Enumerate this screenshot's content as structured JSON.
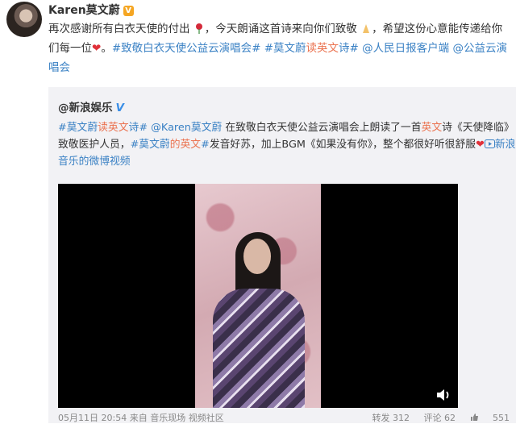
{
  "post": {
    "author": "Karen莫文蔚",
    "text_1": "再次感谢所有白衣天使的付出",
    "text_2": "，今天朗诵这首诗来向你们致敬",
    "text_3": "，希望这份心意能传递给你们每一位",
    "heart": "❤",
    "text_4": "。",
    "tag_1": "#致敬白衣天使公益云演唱会#",
    "tag_2a": "#莫文蔚",
    "tag_2b": "读",
    "tag_2c": "英文",
    "tag_2d": "诗#",
    "mention_1": "@人民日报客户端",
    "mention_2": "@公益云演唱会"
  },
  "repost": {
    "author": "@新浪娱乐",
    "verified": "V",
    "tag_a": "#莫文蔚",
    "tag_b": "读",
    "tag_c": "英文",
    "tag_d": "诗#",
    "mention": "@Karen莫文蔚",
    "text_1": " 在致敬白衣天使公益云演唱会上朗读了一首",
    "eng_1": "英文",
    "text_2": "诗《天使降临》致敬医护人员，",
    "tag_e": "#莫文蔚",
    "tag_f": "的",
    "tag_g": "英文",
    "tag_h": "#",
    "text_3": "发音好苏，加上BGM《如果没有你》，整个都很好听很舒服",
    "heart": "❤",
    "video_link": "新浪音乐的微博视频",
    "time": "05月11日 20:54",
    "source": "来自 音乐现场",
    "community": "视频社区",
    "reposts": "转发 312",
    "comments": "评论 62",
    "likes": "551"
  }
}
